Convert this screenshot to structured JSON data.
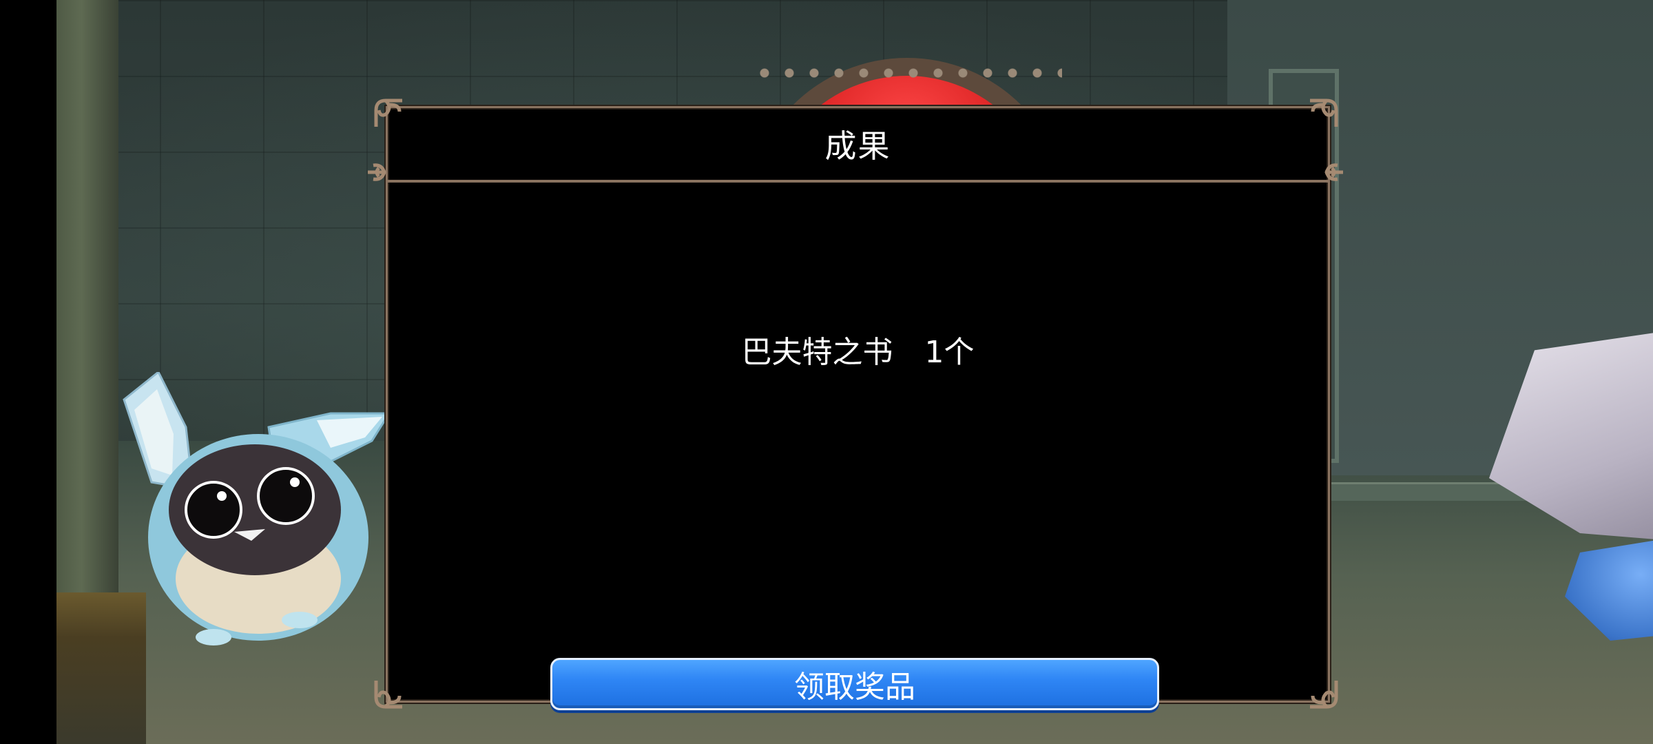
{
  "dialog": {
    "title": "成果",
    "reward": {
      "item_name": "巴夫特之书",
      "quantity": "1个"
    },
    "claim_button_label": "领取奖品"
  },
  "colors": {
    "dialog_border": "#8a7360",
    "button_blue": "#2f86f5",
    "arch_red": "#d51d1d"
  }
}
